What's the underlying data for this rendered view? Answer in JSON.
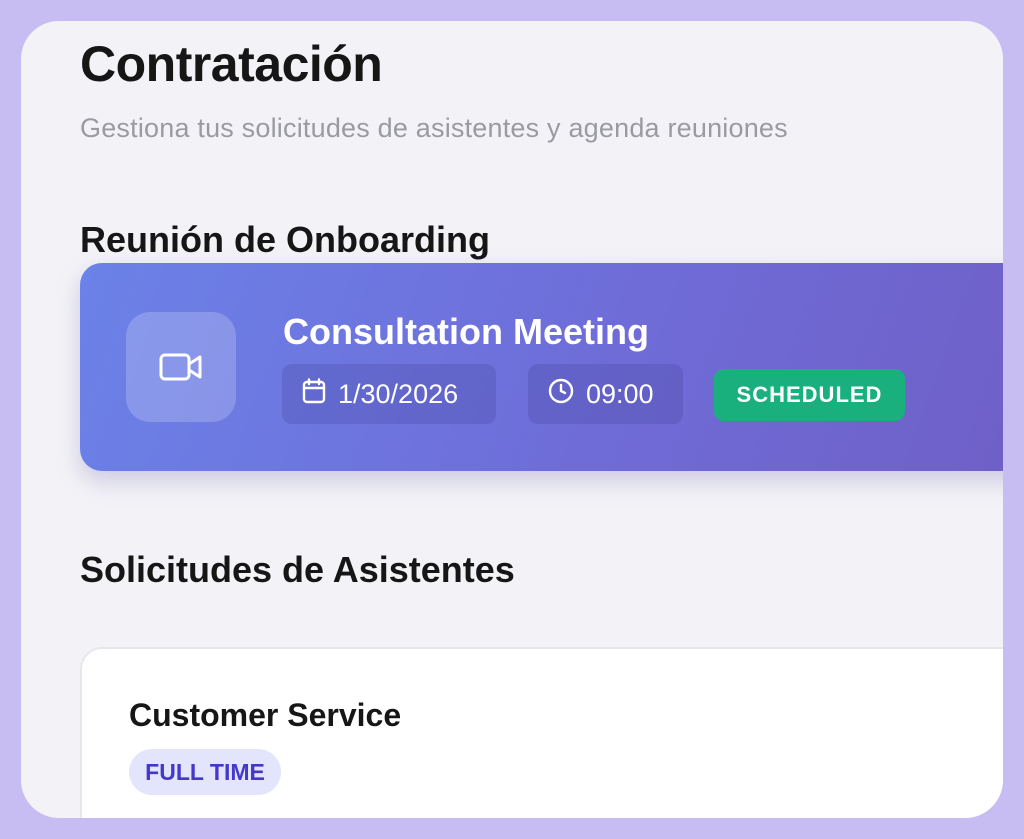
{
  "header": {
    "title": "Contratación",
    "subtitle": "Gestiona tus solicitudes de asistentes y agenda reuniones"
  },
  "onboarding": {
    "section_title": "Reunión de Onboarding",
    "meeting": {
      "icon": "video-camera-icon",
      "title": "Consultation Meeting",
      "date_icon": "calendar-icon",
      "date": "1/30/2026",
      "time_icon": "clock-icon",
      "time": "09:00",
      "status": "SCHEDULED",
      "status_color": "#19b07e"
    }
  },
  "requests": {
    "section_title": "Solicitudes de Asistentes",
    "items": [
      {
        "title": "Customer Service",
        "type": "FULL TIME"
      }
    ]
  },
  "colors": {
    "frame": "#c7bdf2",
    "background": "#f3f3f7",
    "card_gradient_start": "#6b82e8",
    "card_gradient_end": "#6f5fc6",
    "badge_bg": "#e2e5fb",
    "badge_text": "#4438c8"
  }
}
